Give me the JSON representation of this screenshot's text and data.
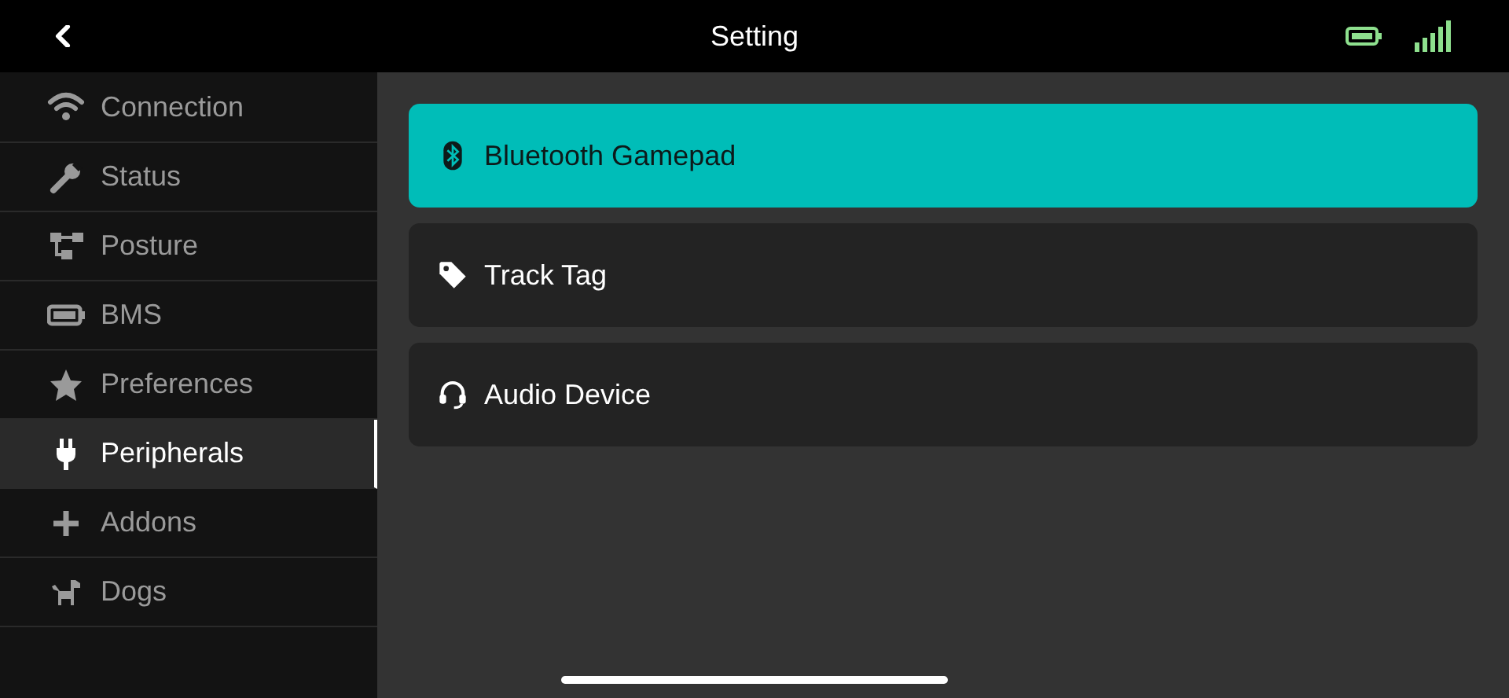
{
  "header": {
    "title": "Setting"
  },
  "sidebar": {
    "items": [
      {
        "label": "Connection",
        "selected": false
      },
      {
        "label": "Status",
        "selected": false
      },
      {
        "label": "Posture",
        "selected": false
      },
      {
        "label": "BMS",
        "selected": false
      },
      {
        "label": "Preferences",
        "selected": false
      },
      {
        "label": "Peripherals",
        "selected": true
      },
      {
        "label": "Addons",
        "selected": false
      },
      {
        "label": "Dogs",
        "selected": false
      }
    ]
  },
  "devices": [
    {
      "label": "Bluetooth Gamepad",
      "selected": true
    },
    {
      "label": "Track Tag",
      "selected": false
    },
    {
      "label": "Audio Device",
      "selected": false
    }
  ]
}
